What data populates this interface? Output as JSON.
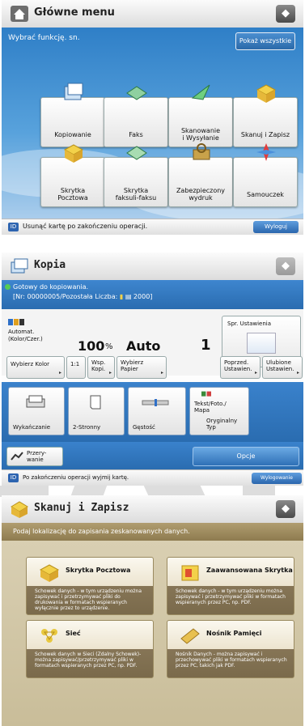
{
  "main_menu": {
    "title": "Główne menu",
    "instruction": "Wybrać funkcję. sn.",
    "show_all": "Pokaż wszystkie",
    "tiles": [
      {
        "label": "Kopiowanie"
      },
      {
        "label": "Faks"
      },
      {
        "label": "Skanowanie\ni Wysyłanie"
      },
      {
        "label": "Skanuj i Zapisz"
      },
      {
        "label": "Skrytka\nPocztowa"
      },
      {
        "label": "Skrytka\nfaksuli-faksu"
      },
      {
        "label": "Zabezpieczony\nwydruk"
      },
      {
        "label": "Samouczek"
      }
    ],
    "footer": "Usunąć kartę po zakończeniu operacji.",
    "logout": "Wyloguj"
  },
  "copy": {
    "title": "Kopia",
    "status_line1": "Gotowy do kopiowania.",
    "status_line2": "[Nr: 00000005/Pozostała Liczba:",
    "status_count": "2000]",
    "color_mode_1": "Automat.",
    "color_mode_2": "(Kolor/Czer.)",
    "zoom_value": "100",
    "zoom_unit": "%",
    "paper": "Auto",
    "copies": "1",
    "settings_check": "Spr. Ustawienia",
    "buttons": [
      {
        "label": "Wybierz Kolor"
      },
      {
        "label": "1:1"
      },
      {
        "label": "Wsp.\nKopi."
      },
      {
        "label": "Wybierz\nPapier"
      },
      {
        "label": "Poprzed.\nUstawien."
      },
      {
        "label": "Ulubione\nUstawien."
      }
    ],
    "functions": [
      {
        "label": "Wykańczanie"
      },
      {
        "label": "2-Stronny"
      },
      {
        "label": "Gęstość"
      },
      {
        "label": "Tekst/Foto./\nMapa"
      },
      {
        "label": "Oryginalny\nTyp"
      }
    ],
    "interrupt": "Przery-\nwanie",
    "options": "Opcje",
    "footer": "Po zakończeniu operacji wyjmij kartę.",
    "logout": "Wylogowanie"
  },
  "scan_store": {
    "title": "Skanuj i Zapisz",
    "instruction": "Podaj lokalizację do zapisania zeskanowanych danych.",
    "tiles": [
      {
        "title": "Skrytka Pocztowa",
        "desc": "Schowek danych - w tym urządzeniu można zapisywać i przetrzymywać pliki do drukowania w formatach wspieranych wyłącznie przez to urządzenie."
      },
      {
        "title": "Zaawansowana Skrytka",
        "desc": "Schowek danych - w tym urządzeniu można zapisywać i przetrzymywać pliki w formatach wspieranych przez PC, np. PDF."
      },
      {
        "title": "Sieć",
        "desc": "Schowek danych w Sieci (Zdalny Schowek)- można zapisywać/przetrzymywać pliki w formatach wspieranych przez PC, np. PDF."
      },
      {
        "title": "Nośnik Pamięci",
        "desc": "Nośnik Danych - można zapisywać i przechowywać pliki w formatach wspieranych przez PC, takich jak PDF."
      }
    ]
  },
  "colors": {
    "accent_blue": "#2a6cb0",
    "scan_brown": "#8e7b4f"
  }
}
